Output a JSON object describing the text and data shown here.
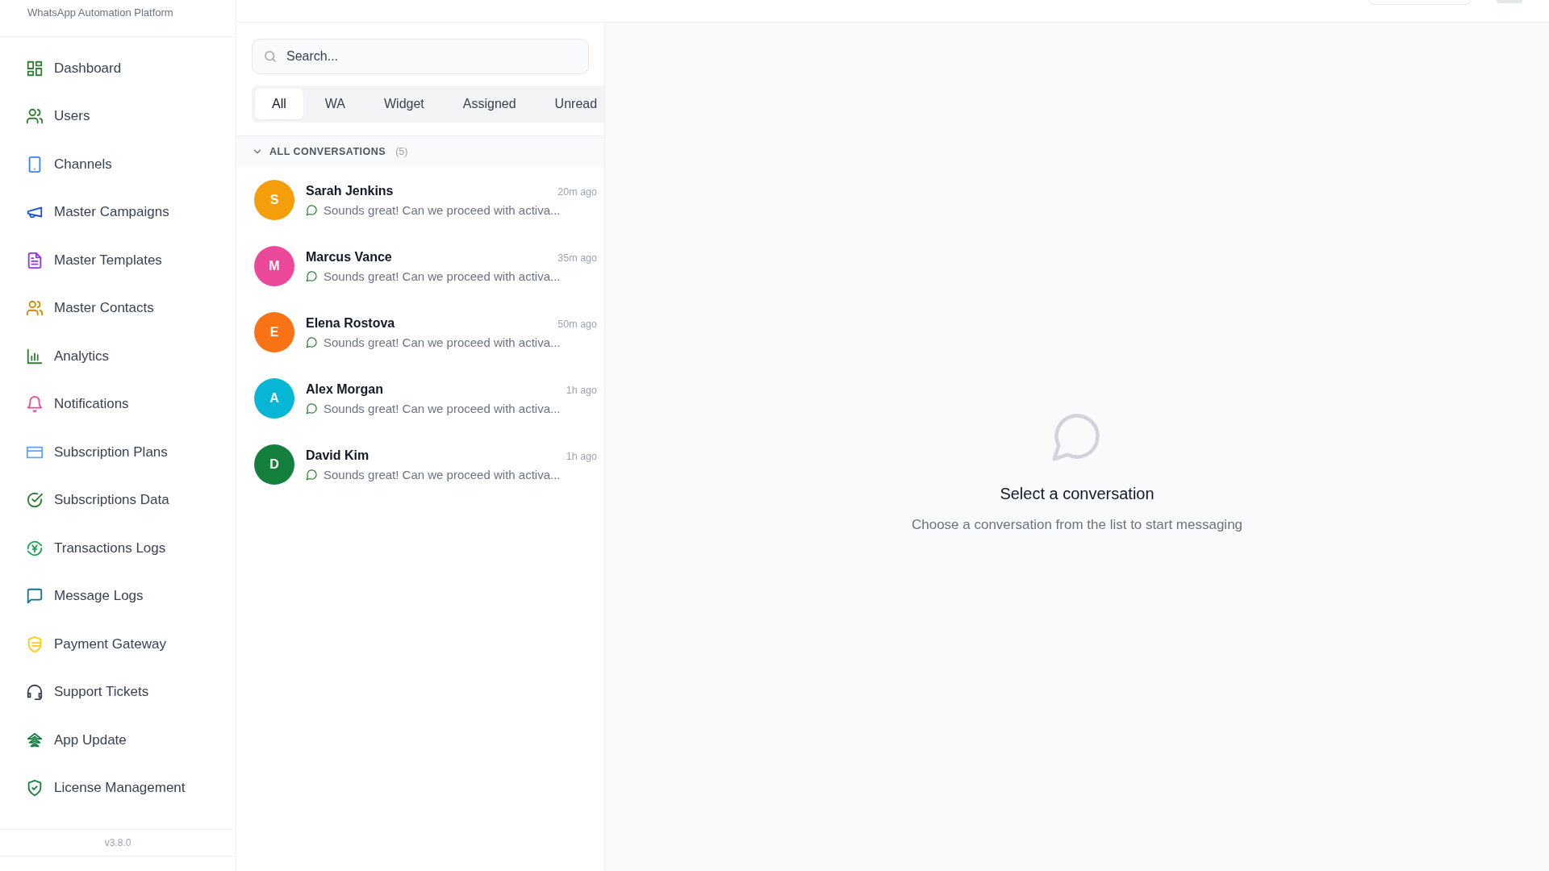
{
  "sidebar": {
    "brand": "WhatsApp Automation Platform",
    "items": [
      {
        "label": "Dashboard",
        "color": "#2e7d32"
      },
      {
        "label": "Users",
        "color": "#2e7d32"
      },
      {
        "label": "Channels",
        "color": "#3b82f6"
      },
      {
        "label": "Master Campaigns",
        "color": "#1d4ed8"
      },
      {
        "label": "Master Templates",
        "color": "#9333ea"
      },
      {
        "label": "Master Contacts",
        "color": "#ca8a04"
      },
      {
        "label": "Analytics",
        "color": "#2e7d32"
      },
      {
        "label": "Notifications",
        "color": "#ec4899"
      },
      {
        "label": "Subscription Plans",
        "color": "#60a5fa"
      },
      {
        "label": "Subscriptions Data",
        "color": "#2e7d32"
      },
      {
        "label": "Transactions Logs",
        "color": "#16a34a"
      },
      {
        "label": "Message Logs",
        "color": "#0e7490"
      },
      {
        "label": "Payment Gateway",
        "color": "#facc15"
      },
      {
        "label": "Support Tickets",
        "color": "#374151"
      },
      {
        "label": "App Update",
        "color": "#15803d"
      },
      {
        "label": "License Management",
        "color": "#15803d"
      }
    ],
    "version": "v3.8.0"
  },
  "conversations_panel": {
    "search": {
      "placeholder": "Search..."
    },
    "tabs": [
      {
        "label": "All",
        "selected": true
      },
      {
        "label": "WA",
        "selected": false
      },
      {
        "label": "Widget",
        "selected": false
      },
      {
        "label": "Assigned",
        "selected": false
      },
      {
        "label": "Unread",
        "selected": false
      }
    ],
    "section": {
      "title": "ALL CONVERSATIONS",
      "count": "(5)",
      "expanded": true
    },
    "conversations": [
      {
        "initial": "S",
        "name": "Sarah Jenkins",
        "time": "20m ago",
        "preview": "Sounds great! Can we proceed with activa...",
        "color": "#f59e0b"
      },
      {
        "initial": "M",
        "name": "Marcus Vance",
        "time": "35m ago",
        "preview": "Sounds great! Can we proceed with activa...",
        "color": "#ec4899"
      },
      {
        "initial": "E",
        "name": "Elena Rostova",
        "time": "50m ago",
        "preview": "Sounds great! Can we proceed with activa...",
        "color": "#f97316"
      },
      {
        "initial": "A",
        "name": "Alex Morgan",
        "time": "1h ago",
        "preview": "Sounds great! Can we proceed with activa...",
        "color": "#06b6d4"
      },
      {
        "initial": "D",
        "name": "David Kim",
        "time": "1h ago",
        "preview": "Sounds great! Can we proceed with activa...",
        "color": "#15803d"
      }
    ]
  },
  "empty_state": {
    "title": "Select a conversation",
    "subtitle": "Choose a conversation from the list to start messaging"
  }
}
